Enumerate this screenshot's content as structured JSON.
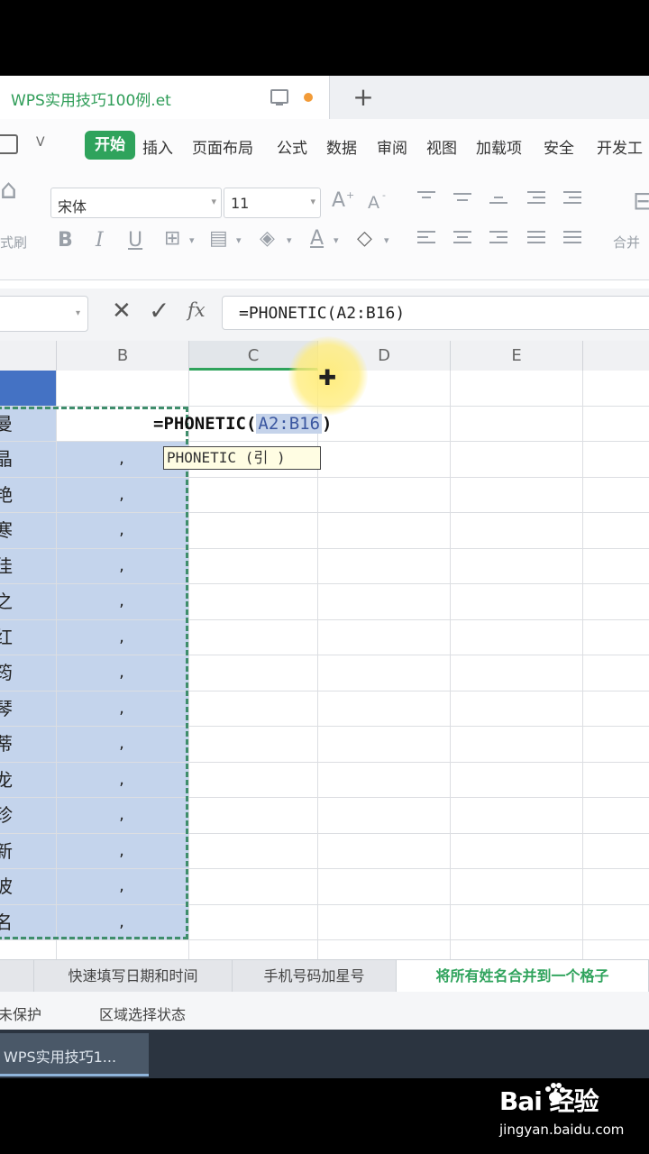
{
  "window": {
    "doc_tab_title": "WPS实用技巧100例.et",
    "new_tab_symbol": "+"
  },
  "menu": {
    "items": [
      "开始",
      "插入",
      "页面布局",
      "公式",
      "数据",
      "审阅",
      "视图",
      "加载项",
      "安全",
      "开发工"
    ]
  },
  "toolbar": {
    "font_name": "宋体",
    "font_size": "11",
    "grow_font": "A",
    "shrink_font": "A",
    "bold": "B",
    "italic": "I",
    "underline": "U",
    "font_color": "A",
    "painter_label": "式刷",
    "merge_label": "合并"
  },
  "formula_bar": {
    "formula": "=PHONETIC(A2:B16)",
    "fx": "fx"
  },
  "columns": [
    "B",
    "C",
    "D",
    "E"
  ],
  "grid": {
    "a_column": [
      "曼",
      "晶",
      "艳",
      "寒",
      "佳",
      "之",
      "红",
      "筠",
      "琴",
      "蒂",
      "龙",
      "珍",
      "新",
      "波",
      "名"
    ],
    "b_column_value": ",",
    "edit_prefix": "=PHONETIC(",
    "edit_ref": "A2:B16",
    "edit_suffix": ")",
    "tooltip": "PHONETIC (引  )"
  },
  "sheet_tabs": [
    "快速填写日期和时间",
    "手机号码加星号",
    "将所有姓名合并到一个格子"
  ],
  "status": {
    "protection": "未保护",
    "selection_state": "区域选择状态"
  },
  "taskbar": {
    "item": "WPS实用技巧1..."
  },
  "watermark": {
    "logo": "Bai  经验",
    "url": "jingyan.baidu.com"
  },
  "colors": {
    "accent_green": "#2fa35c",
    "selection_blue": "#c4d4ec",
    "header_blue": "#4472c4"
  }
}
